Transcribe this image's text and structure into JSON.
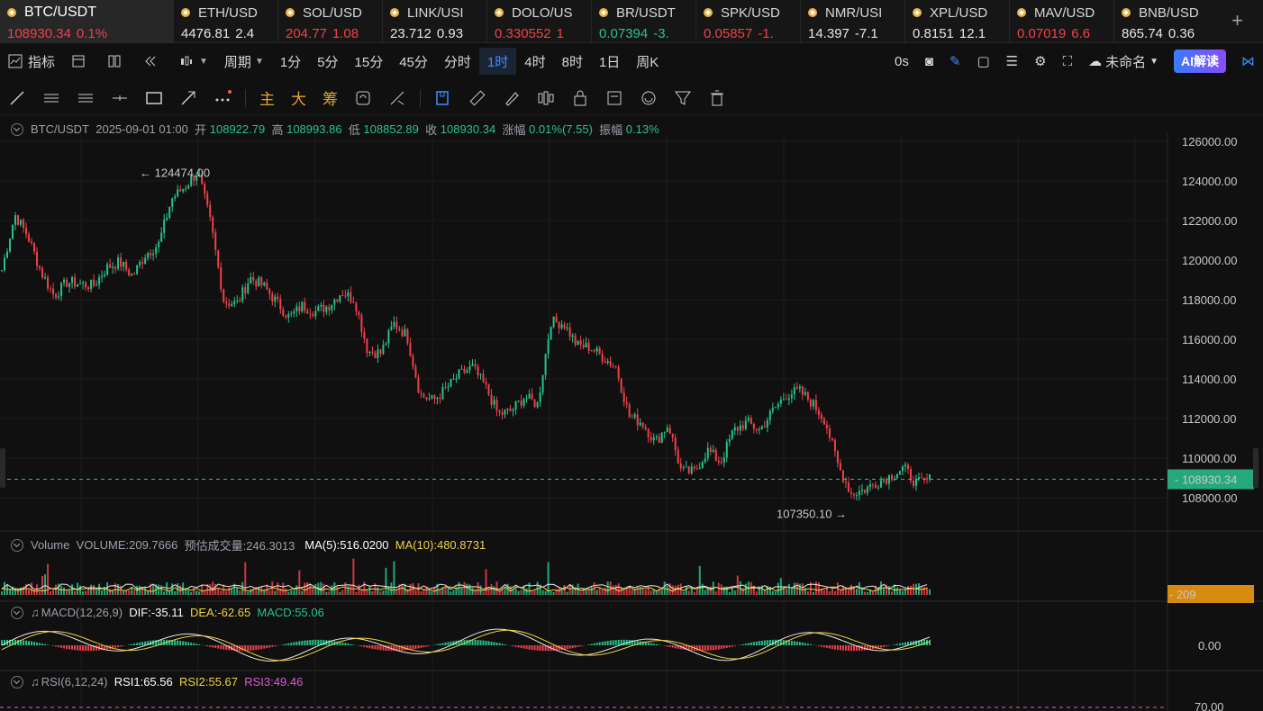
{
  "ticker": [
    {
      "symbol": "BTC/USDT",
      "price": "108930.34",
      "change": "0.1%",
      "dir": "dn",
      "first": true
    },
    {
      "symbol": "ETH/USD",
      "price": "4476.81",
      "change": "2.4",
      "dir": "wh"
    },
    {
      "symbol": "SOL/USD",
      "price": "204.77",
      "change": "1.08",
      "dir": "dn"
    },
    {
      "symbol": "LINK/USI",
      "price": "23.712",
      "change": "0.93",
      "dir": "wh"
    },
    {
      "symbol": "DOLO/US",
      "price": "0.330552",
      "change": "1",
      "dir": "dn"
    },
    {
      "symbol": "BR/USDT",
      "price": "0.07394",
      "change": "-3.",
      "dir": "up"
    },
    {
      "symbol": "SPK/USD",
      "price": "0.05857",
      "change": "-1.",
      "dir": "dn"
    },
    {
      "symbol": "NMR/USI",
      "price": "14.397",
      "change": "-7.1",
      "dir": "wh"
    },
    {
      "symbol": "XPL/USD",
      "price": "0.8151",
      "change": "12.1",
      "dir": "wh"
    },
    {
      "symbol": "MAV/USD",
      "price": "0.07019",
      "change": "6.6",
      "dir": "dn"
    },
    {
      "symbol": "BNB/USD",
      "price": "865.74",
      "change": "0.36",
      "dir": "wh"
    }
  ],
  "toolbar": {
    "indicator": "指标",
    "period": "周期",
    "intervals": [
      "1分",
      "5分",
      "15分",
      "45分",
      "分时",
      "1时",
      "4时",
      "8时",
      "1日",
      "周K"
    ],
    "active_interval": "1时",
    "countdown": "0s",
    "layout_name": "未命名",
    "ai_button": "AI解读"
  },
  "drawbar": {
    "main": "主",
    "big": "大",
    "chip": "筹"
  },
  "info": {
    "pair": "BTC/USDT",
    "time": "2025-09-01 01:00",
    "open_label": "开",
    "open": "108922.79",
    "high_label": "高",
    "high": "108993.86",
    "low_label": "低",
    "low": "108852.89",
    "close_label": "收",
    "close": "108930.34",
    "chg_label": "涨幅",
    "chg": "0.01%(7.55)",
    "amp_label": "振幅",
    "amp": "0.13%"
  },
  "volume": {
    "title": "Volume",
    "vol": "VOLUME:209.7666",
    "est": "预估成交量:246.3013",
    "ma5": "MA(5):516.0200",
    "ma10": "MA(10):480.8731",
    "last_label": "209"
  },
  "macd": {
    "title": "MACD(12,26,9)",
    "dif": "DIF:-35.11",
    "dea": "DEA:-62.65",
    "macd": "MACD:55.06",
    "zero": "0.00"
  },
  "rsi": {
    "title": "RSI(6,12,24)",
    "rsi1": "RSI1:65.56",
    "rsi2": "RSI2:55.67",
    "rsi3": "RSI3:49.46",
    "level": "70.00"
  },
  "chart_data": {
    "type": "candlestick",
    "ylim": [
      107000,
      126500
    ],
    "yticks": [
      126000,
      124000,
      122000,
      120000,
      118000,
      116000,
      114000,
      112000,
      110000,
      108000
    ],
    "ytick_labels": [
      "126000.00",
      "124000.00",
      "122000.00",
      "120000.00",
      "118000.00",
      "116000.00",
      "114000.00",
      "112000.00",
      "110000.00",
      "108000.00"
    ],
    "high_marker": "124474.00",
    "high_value": 124474,
    "low_marker": "107350.10",
    "low_value": 107350.1,
    "last_price_label": "108930.34",
    "last_price": 108930.34,
    "up_color": "#26c289",
    "down_color": "#f0404a",
    "close_path": [
      119500,
      122300,
      121200,
      119400,
      118200,
      118900,
      118800,
      118700,
      119600,
      119900,
      119200,
      120300,
      120800,
      123100,
      123700,
      124474,
      121800,
      117900,
      117800,
      119100,
      118700,
      117900,
      117100,
      117700,
      117400,
      117700,
      118400,
      118000,
      115400,
      115300,
      116800,
      116200,
      113200,
      112900,
      113500,
      114200,
      114600,
      113600,
      112200,
      112400,
      113100,
      112700,
      116900,
      116800,
      115700,
      115600,
      115100,
      114600,
      112100,
      111800,
      110800,
      111700,
      109300,
      109300,
      110400,
      109800,
      111400,
      111800,
      111400,
      112400,
      113200,
      113400,
      112800,
      111900,
      109600,
      108200,
      108400,
      108800,
      109100,
      109500,
      108700,
      108930
    ]
  }
}
